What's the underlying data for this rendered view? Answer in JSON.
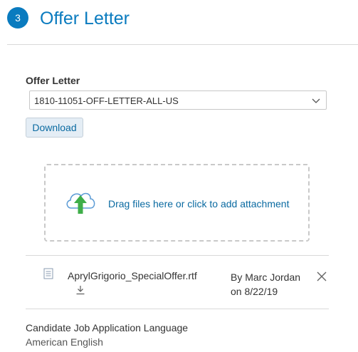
{
  "step": {
    "number": "3",
    "title": "Offer Letter"
  },
  "offer_letter": {
    "label": "Offer Letter",
    "selected_value": "1810-11051-OFF-LETTER-ALL-US",
    "download_label": "Download"
  },
  "dropzone": {
    "text": "Drag files here or click to add attachment",
    "icon": "upload-cloud-icon"
  },
  "attachment": {
    "file_name": "AprylGrigorio_SpecialOffer.rtf",
    "by_line1": "By Marc Jordan",
    "by_line2": "on 8/22/19"
  },
  "language": {
    "label": "Candidate Job Application Language",
    "value": "American English"
  },
  "colors": {
    "accent": "#0a7bbf",
    "link": "#0a6aa1",
    "upload_arrow": "#3fae49"
  }
}
